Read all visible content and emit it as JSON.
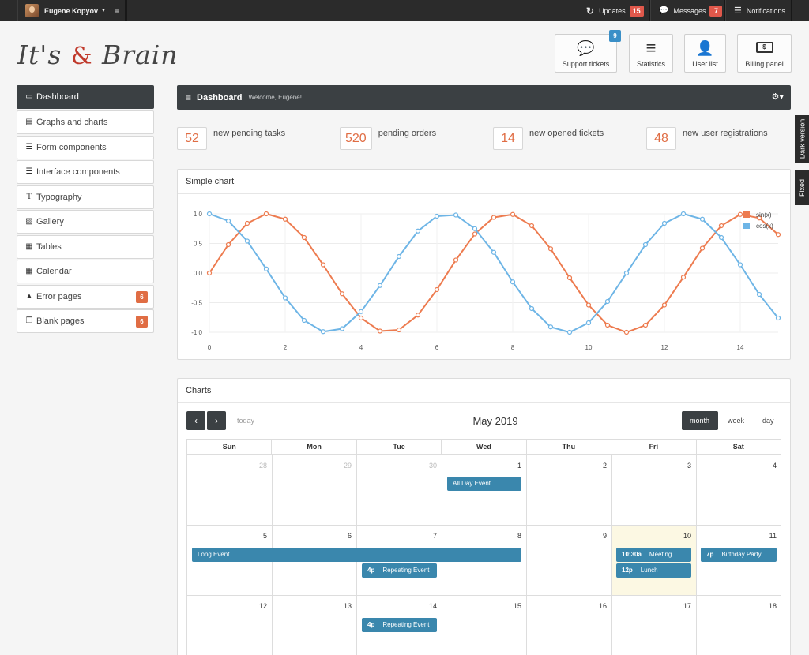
{
  "topbar": {
    "user_name": "Eugene Kopyov",
    "updates_label": "Updates",
    "updates_count": "15",
    "messages_label": "Messages",
    "messages_count": "7",
    "notifications_label": "Notifications"
  },
  "brand": {
    "part1": "It's",
    "part2": "Brain"
  },
  "top_buttons": [
    {
      "label": "Support tickets",
      "badge": "9",
      "icon": "comments-icon"
    },
    {
      "label": "Statistics",
      "icon": "bars-icon"
    },
    {
      "label": "User list",
      "icon": "user-icon"
    },
    {
      "label": "Billing panel",
      "icon": "money-icon"
    }
  ],
  "sidebar": {
    "items": [
      {
        "label": "Dashboard",
        "icon": "laptop-icon"
      },
      {
        "label": "Graphs and charts",
        "icon": "chart-icon"
      },
      {
        "label": "Form components",
        "icon": "list-icon"
      },
      {
        "label": "Interface components",
        "icon": "list-icon"
      },
      {
        "label": "Typography",
        "icon": "text-icon"
      },
      {
        "label": "Gallery",
        "icon": "image-icon"
      },
      {
        "label": "Tables",
        "icon": "table-icon"
      },
      {
        "label": "Calendar",
        "icon": "calendar-icon"
      },
      {
        "label": "Error pages",
        "icon": "warning-icon",
        "badge": "6"
      },
      {
        "label": "Blank pages",
        "icon": "copy-icon",
        "badge": "6"
      }
    ]
  },
  "main": {
    "title": "Dashboard",
    "welcome": "Welcome, Eugene!"
  },
  "stats": [
    {
      "value": "52",
      "label": "new pending tasks"
    },
    {
      "value": "520",
      "label": "pending orders"
    },
    {
      "value": "14",
      "label": "new opened tickets"
    },
    {
      "value": "48",
      "label": "new user registrations"
    }
  ],
  "side_tabs": {
    "dark": "Dark version",
    "fixed": "Fixed"
  },
  "chart_panel": {
    "title": "Simple chart"
  },
  "chart_data": {
    "type": "line",
    "x": [
      0,
      0.5,
      1,
      1.5,
      2,
      2.5,
      3,
      3.5,
      4,
      4.5,
      5,
      5.5,
      6,
      6.5,
      7,
      7.5,
      8,
      8.5,
      9,
      9.5,
      10,
      10.5,
      11,
      11.5,
      12,
      12.5,
      13,
      13.5,
      14,
      14.5,
      15
    ],
    "series": [
      {
        "name": "sin(x)",
        "color": "#ed7b4f",
        "values": [
          0,
          0.48,
          0.84,
          1.0,
          0.91,
          0.6,
          0.14,
          -0.35,
          -0.76,
          -0.98,
          -0.96,
          -0.71,
          -0.28,
          0.22,
          0.66,
          0.94,
          0.99,
          0.8,
          0.41,
          -0.08,
          -0.54,
          -0.88,
          -1.0,
          -0.88,
          -0.54,
          -0.07,
          0.42,
          0.8,
          0.99,
          0.93,
          0.65
        ]
      },
      {
        "name": "cos(x)",
        "color": "#6eb5e6",
        "values": [
          1.0,
          0.88,
          0.54,
          0.07,
          -0.42,
          -0.8,
          -0.99,
          -0.94,
          -0.65,
          -0.21,
          0.28,
          0.71,
          0.96,
          0.98,
          0.75,
          0.35,
          -0.15,
          -0.6,
          -0.91,
          -1.0,
          -0.84,
          -0.48,
          0.0,
          0.48,
          0.84,
          1.0,
          0.91,
          0.6,
          0.14,
          -0.36,
          -0.76
        ]
      }
    ],
    "xlim": [
      0,
      15
    ],
    "ylim": [
      -1.0,
      1.0
    ],
    "xticks": [
      "0",
      "2",
      "4",
      "6",
      "8",
      "10",
      "12",
      "14"
    ],
    "yticks": [
      "1.0",
      "0.5",
      "0.0",
      "-0.5",
      "-1.0"
    ],
    "legend": "top-right",
    "grid": true
  },
  "calendar_panel": {
    "title": "Charts"
  },
  "calendar": {
    "month_title": "May 2019",
    "today_label": "today",
    "prev_icon": "‹",
    "next_icon": "›",
    "views": [
      "month",
      "week",
      "day"
    ],
    "weekdays": [
      "Sun",
      "Mon",
      "Tue",
      "Wed",
      "Thu",
      "Fri",
      "Sat"
    ],
    "weeks": [
      [
        "28",
        "29",
        "30",
        "1",
        "2",
        "3",
        "4"
      ],
      [
        "5",
        "6",
        "7",
        "8",
        "9",
        "10",
        "11"
      ],
      [
        "12",
        "13",
        "14",
        "15",
        "16",
        "17",
        "18"
      ]
    ],
    "events": {
      "all_day": "All Day Event",
      "long": "Long Event",
      "repeat_time": "4p",
      "repeat_title": "Repeating Event",
      "meeting_time": "10:30a",
      "meeting_title": "Meeting",
      "lunch_time": "12p",
      "lunch_title": "Lunch",
      "party_time": "7p",
      "party_title": "Birthday Party",
      "repeat2_time": "4p",
      "repeat2_title": "Repeating Event"
    }
  }
}
